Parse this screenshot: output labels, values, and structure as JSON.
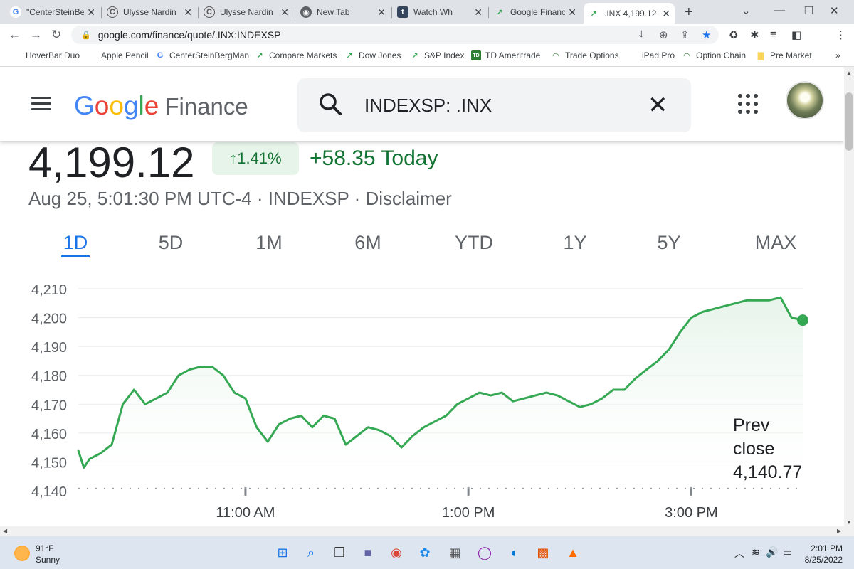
{
  "browser": {
    "tabs": [
      {
        "title": "\"CenterSteinBe",
        "icon": "google-g-icon",
        "active": false
      },
      {
        "title": "Ulysse Nardin",
        "icon": "c-logo-icon",
        "active": false
      },
      {
        "title": "Ulysse Nardin",
        "icon": "c-logo-icon",
        "active": false
      },
      {
        "title": "New Tab",
        "icon": "chrome-icon",
        "active": false
      },
      {
        "title": "Watch Wh",
        "icon": "tumblr-icon",
        "active": false
      },
      {
        "title": "Google Financ",
        "icon": "google-finance-icon",
        "active": false
      },
      {
        "title": ".INX 4,199.12 (",
        "icon": "google-finance-icon",
        "active": true
      }
    ],
    "url": "google.com/finance/quote/.INX:INDEXSP",
    "bookmarks": [
      {
        "label": "HoverBar Duo",
        "icon": "apple-icon"
      },
      {
        "label": "Apple Pencil",
        "icon": "apple-icon"
      },
      {
        "label": "CenterSteinBergMan",
        "icon": "google-g-icon"
      },
      {
        "label": "Compare Markets",
        "icon": "google-finance-icon"
      },
      {
        "label": "Dow Jones",
        "icon": "google-finance-icon"
      },
      {
        "label": "S&P Index",
        "icon": "google-finance-icon"
      },
      {
        "label": "TD Ameritrade",
        "icon": "td-icon"
      },
      {
        "label": "Trade Options",
        "icon": "options-icon"
      },
      {
        "label": "iPad Pro",
        "icon": "apple-icon"
      },
      {
        "label": "Option Chain",
        "icon": "options-icon"
      },
      {
        "label": "Pre Market",
        "icon": "folder-icon"
      }
    ],
    "bookmarks_overflow": "»"
  },
  "header": {
    "logo_google": [
      "G",
      "o",
      "o",
      "g",
      "l",
      "e"
    ],
    "logo_finance": "Finance",
    "search_query": "INDEXSP: .INX"
  },
  "quote": {
    "price": "4,199.12",
    "change_percent": "↑1.41%",
    "change_today": "+58.35 Today",
    "meta": "Aug 25, 5:01:30 PM UTC-4 · INDEXSP · Disclaimer"
  },
  "ranges": {
    "items": [
      "1D",
      "5D",
      "1M",
      "6M",
      "YTD",
      "1Y",
      "5Y",
      "MAX"
    ],
    "selected": "1D"
  },
  "prev_close": {
    "line1": "Prev",
    "line2": "close",
    "value": "4,140.77"
  },
  "colors": {
    "line": "#34a853",
    "fill_top": "#e6f4ea",
    "positive_text": "#137333",
    "accent": "#1a73e8"
  },
  "chart_data": {
    "type": "line",
    "ylim": [
      4140,
      4210
    ],
    "yticks": [
      4140,
      4150,
      4160,
      4170,
      4180,
      4190,
      4200,
      4210
    ],
    "ytick_labels": [
      "4,140",
      "4,150",
      "4,160",
      "4,170",
      "4,180",
      "4,190",
      "4,200",
      "4,210"
    ],
    "xlim": [
      9.5,
      16.0
    ],
    "xticks": [
      11,
      13,
      15
    ],
    "xtick_labels": [
      "11:00 AM",
      "1:00 PM",
      "3:00 PM"
    ],
    "prev_close": 4140.77,
    "series": [
      {
        "x": [
          9.5,
          9.55,
          9.6,
          9.7,
          9.8,
          9.9,
          10.0,
          10.1,
          10.2,
          10.3,
          10.4,
          10.5,
          10.6,
          10.7,
          10.8,
          10.9,
          11.0,
          11.1,
          11.2,
          11.3,
          11.4,
          11.5,
          11.6,
          11.7,
          11.8,
          11.9,
          12.0,
          12.1,
          12.2,
          12.3,
          12.4,
          12.5,
          12.6,
          12.7,
          12.8,
          12.9,
          13.0,
          13.1,
          13.2,
          13.3,
          13.4,
          13.5,
          13.6,
          13.7,
          13.8,
          13.9,
          14.0,
          14.1,
          14.2,
          14.3,
          14.4,
          14.5,
          14.6,
          14.7,
          14.8,
          14.9,
          15.0,
          15.1,
          15.2,
          15.3,
          15.4,
          15.5,
          15.6,
          15.7,
          15.8,
          15.9,
          16.0
        ],
        "y": [
          4154,
          4148,
          4151,
          4153,
          4156,
          4170,
          4175,
          4170,
          4172,
          4174,
          4180,
          4182,
          4183,
          4183,
          4180,
          4174,
          4172,
          4162,
          4157,
          4163,
          4165,
          4166,
          4162,
          4166,
          4165,
          4156,
          4159,
          4162,
          4161,
          4159,
          4155,
          4159,
          4162,
          4164,
          4166,
          4170,
          4172,
          4174,
          4173,
          4174,
          4171,
          4172,
          4173,
          4174,
          4173,
          4171,
          4169,
          4170,
          4172,
          4175,
          4175,
          4179,
          4182,
          4185,
          4189,
          4195,
          4200,
          4202,
          4203,
          4204,
          4205,
          4206,
          4206,
          4206,
          4207,
          4200,
          4199.12
        ]
      }
    ]
  },
  "taskbar": {
    "weather_temp": "91°F",
    "weather_cond": "Sunny",
    "time": "2:01 PM",
    "date": "8/25/2022"
  }
}
